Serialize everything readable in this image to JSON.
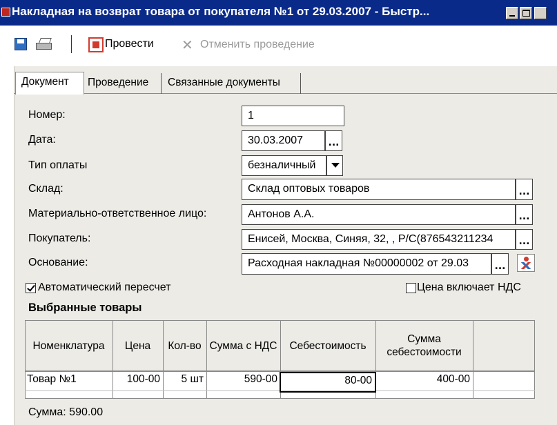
{
  "window": {
    "title": "Накладная на возврат товара от покупателя №1 от 29.03.2007 - Быстр..."
  },
  "toolbar": {
    "post_label": "Провести",
    "cancel_label": "Отменить проведение"
  },
  "tabs": [
    {
      "label": "Документ",
      "active": true
    },
    {
      "label": "Проведение",
      "active": false
    },
    {
      "label": "Связанные документы",
      "active": false
    }
  ],
  "form": {
    "number_label": "Номер:",
    "number_value": "1",
    "date_label": "Дата:",
    "date_value": "30.03.2007",
    "payment_label": "Тип оплаты",
    "payment_value": "безналичный",
    "warehouse_label": "Склад:",
    "warehouse_value": "Склад оптовых товаров",
    "mol_label": "Материально-ответственное лицо:",
    "mol_value": "Антонов А.А.",
    "buyer_label": "Покупатель:",
    "buyer_value": "Енисей, Москва, Синяя, 32, , Р/С(876543211234",
    "basis_label": "Основание:",
    "basis_value": "Расходная накладная №00000002 от 29.03",
    "auto_recalc_label": "Автоматический пересчет",
    "auto_recalc_checked": true,
    "price_vat_label": "Цена включает НДС",
    "price_vat_checked": false
  },
  "goods": {
    "title": "Выбранные товары",
    "headers": [
      "Номенклатура",
      "Цена",
      "Кол-во",
      "Сумма с НДС",
      "Себестоимость",
      "Сумма себестоимости"
    ],
    "rows": [
      [
        "Товар №1",
        "100-00",
        "5 шт",
        "590-00",
        "80-00",
        "400-00"
      ]
    ]
  },
  "summary": {
    "sum_text": "Сумма:   590.00"
  }
}
